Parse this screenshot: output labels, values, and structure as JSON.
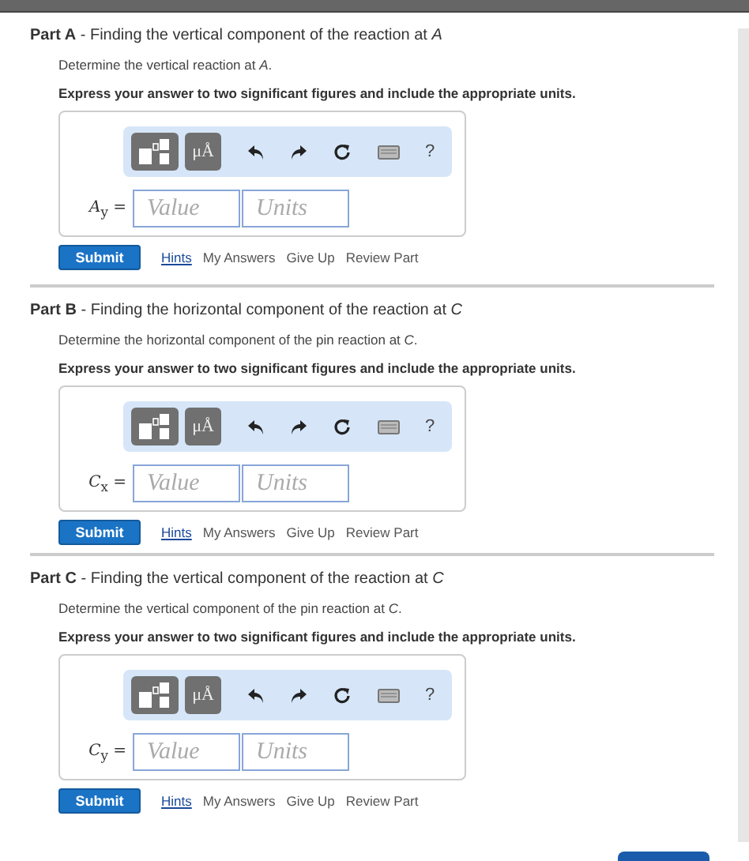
{
  "parts": [
    {
      "title": "**Part A** - Finding the vertical component of the reaction at *A*",
      "description": "Determine the vertical reaction at *A*.",
      "instruction": "Express your answer to two significant figures and include the appropriate units.",
      "toolbar": {
        "units_button": "μÅ",
        "help": "?"
      },
      "answer_label": "*A*$_{y}$ =",
      "value": {
        "placeholder": "Value"
      },
      "units": {
        "placeholder": "Units"
      },
      "submit": "Submit",
      "links": [
        "Hints",
        "My Answers",
        "Give Up",
        "Review Part"
      ]
    },
    {
      "title": "**Part B** - Finding the horizontal component of the reaction at *C*",
      "description": "Determine the horizontal component of the pin reaction at *C*.",
      "instruction": "Express your answer to two significant figures and include the appropriate units.",
      "toolbar": {
        "units_button": "μÅ",
        "help": "?"
      },
      "answer_label": "*C*$_{x}$ =",
      "value": {
        "placeholder": "Value"
      },
      "units": {
        "placeholder": "Units"
      },
      "submit": "Submit",
      "links": [
        "Hints",
        "My Answers",
        "Give Up",
        "Review Part"
      ]
    },
    {
      "title": "**Part C** - Finding the vertical component of the reaction at *C*",
      "description": "Determine the vertical component of the pin reaction at *C*.",
      "instruction": "Express your answer to two significant figures and include the appropriate units.",
      "toolbar": {
        "units_button": "μÅ",
        "help": "?"
      },
      "answer_label": "*C*$_{y}$ =",
      "value": {
        "placeholder": "Value"
      },
      "units": {
        "placeholder": "Units"
      },
      "submit": "Submit",
      "links": [
        "Hints",
        "My Answers",
        "Give Up",
        "Review Part"
      ]
    }
  ]
}
